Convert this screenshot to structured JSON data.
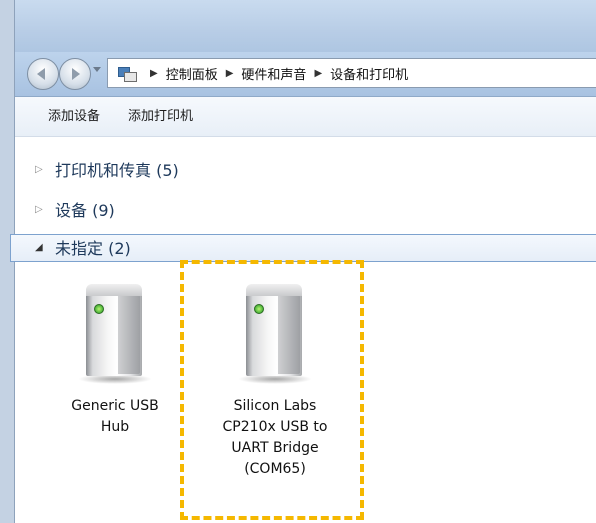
{
  "breadcrumb": [
    "控制面板",
    "硬件和声音",
    "设备和打印机"
  ],
  "toolbar": {
    "add_device": "添加设备",
    "add_printer": "添加打印机"
  },
  "groups": [
    {
      "label": "打印机和传真 (5)",
      "expanded": false
    },
    {
      "label": "设备 (9)",
      "expanded": false
    },
    {
      "label": "未指定 (2)",
      "expanded": true
    }
  ],
  "devices": [
    {
      "label_line1": "Generic USB",
      "label_line2": "Hub",
      "icon": "usb-device-icon"
    },
    {
      "label_line1": "Silicon Labs",
      "label_line2": "CP210x USB to",
      "label_line3": "UART Bridge",
      "label_line4": "(COM65)",
      "icon": "usb-device-icon"
    }
  ],
  "colors": {
    "highlight": "#f5b800",
    "group_text": "#1e395b"
  }
}
